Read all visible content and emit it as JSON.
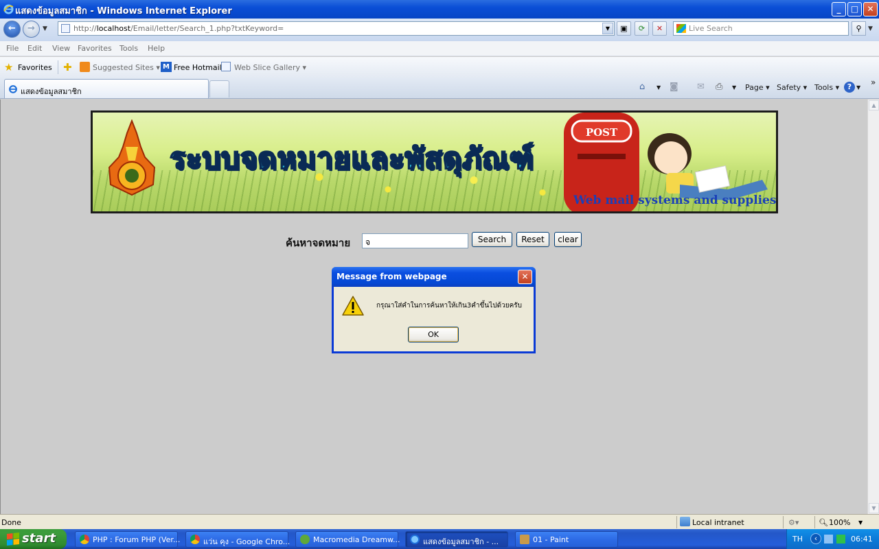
{
  "window": {
    "title": "แสดงข้อมูลสมาชิก - Windows Internet Explorer",
    "controls": {
      "minimize": "_",
      "maximize": "□",
      "close": "✕"
    }
  },
  "address_bar": {
    "url_prefix": "http://",
    "url_host": "localhost",
    "url_path": "/Email/letter/Search_1.php?txtKeyword=",
    "search_placeholder": "Live Search"
  },
  "menu": [
    "File",
    "Edit",
    "View",
    "Favorites",
    "Tools",
    "Help"
  ],
  "favorites_bar": {
    "favorites_label": "Favorites",
    "items": [
      "Suggested Sites",
      "Free Hotmail",
      "Web Slice Gallery"
    ]
  },
  "tabs": [
    {
      "label": "แสดงข้อมูลสมาชิก"
    }
  ],
  "command_bar": {
    "page": "Page",
    "safety": "Safety",
    "tools": "Tools"
  },
  "banner": {
    "thai_title": "ระบบจดหมายและพัสดุภัณฑ์",
    "english_title": "Web mail systems and supplies",
    "postbox_text": "POST"
  },
  "search_form": {
    "label": "ค้นหาจดหมาย",
    "input_value": "จ",
    "buttons": {
      "search": "Search",
      "reset": "Reset",
      "clear": "clear"
    }
  },
  "dialog": {
    "title": "Message from webpage",
    "message": "กรุณาใส่คำในการค้นหาให้เกิน3คำขึ้นไปด้วยครับ",
    "ok": "OK"
  },
  "status_bar": {
    "status": "Done",
    "zone": "Local intranet",
    "zoom": "100%"
  },
  "taskbar": {
    "start": "start",
    "tasks": [
      {
        "label": "PHP : Forum PHP (Ver...",
        "icon": "chrome-icon"
      },
      {
        "label": "แว่น คุง - Google Chro...",
        "icon": "chrome-icon"
      },
      {
        "label": "Macromedia Dreamw...",
        "icon": "dreamweaver-icon"
      },
      {
        "label": "แสดงข้อมูลสมาชิก - ...",
        "icon": "ie-icon"
      },
      {
        "label": "01 - Paint",
        "icon": "paint-icon"
      }
    ],
    "tray": {
      "lang": "TH",
      "time": "06:41"
    }
  },
  "colors": {
    "titlebar": "#0a4ed6",
    "content_bg": "#cccccc",
    "dialog_bg": "#ece9d8",
    "taskbar": "#245edb",
    "start": "#3c9c3c"
  }
}
